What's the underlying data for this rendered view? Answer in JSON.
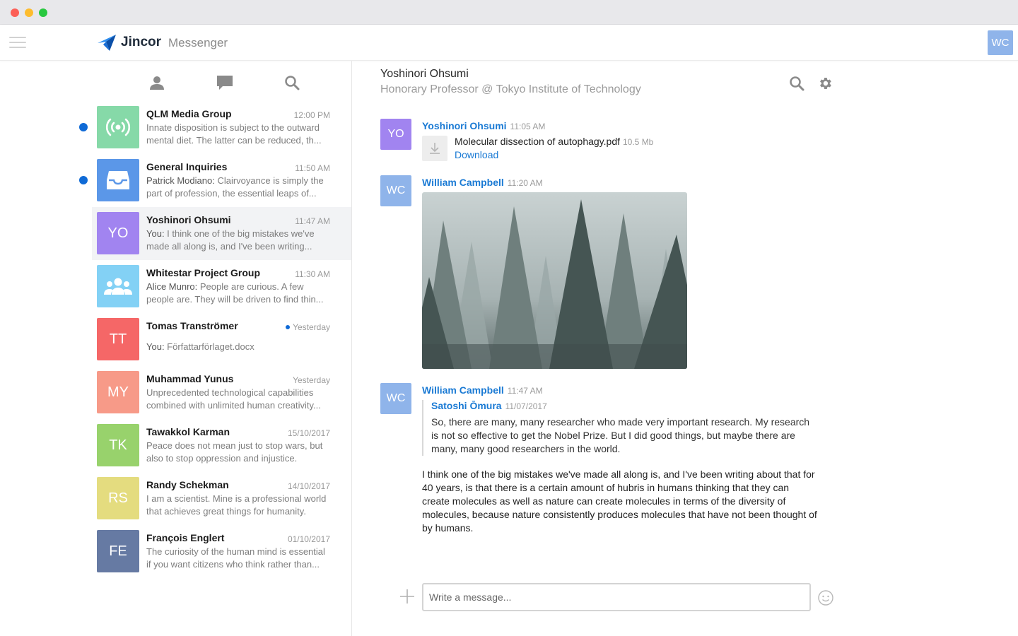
{
  "window": {
    "controls": [
      "close",
      "minimize",
      "maximize"
    ]
  },
  "header": {
    "brand": "Jincor",
    "subtitle": "Messenger",
    "user_initials": "WC",
    "user_color": "#8fb4ea"
  },
  "sidebar": {
    "tabs": [
      {
        "icon": "contacts-icon"
      },
      {
        "icon": "chat-bubble-icon"
      },
      {
        "icon": "search-icon"
      }
    ],
    "conversations": [
      {
        "name": "QLM Media Group",
        "time": "12:00 PM",
        "sender": "",
        "preview": "Innate disposition is subject to the outward mental diet. The latter can be reduced, th...",
        "avatar_icon": "broadcast-icon",
        "avatar_color": "#86d9a8",
        "unread": true
      },
      {
        "name": "General Inquiries",
        "time": "11:50 AM",
        "sender": "Patrick Modiano:",
        "preview": " Clairvoyance is simply the part of profession, the essential leaps of...",
        "avatar_icon": "inbox-icon",
        "avatar_color": "#5b97e8",
        "unread": true
      },
      {
        "name": "Yoshinori Ohsumi",
        "time": "11:47 AM",
        "sender": "You:",
        "preview": " I think one of the big mistakes we've made all along is, and I've been writing...",
        "initials": "YO",
        "avatar_color": "#a184f0",
        "active": true
      },
      {
        "name": "Whitestar Project Group",
        "time": "11:30 AM",
        "sender": "Alice Munro:",
        "preview": "  People are curious. A few people are. They will be driven to find thin...",
        "avatar_icon": "group-icon",
        "avatar_color": "#83d1f5"
      },
      {
        "name": "Tomas Tranströmer",
        "time": "Yesterday",
        "sender": "You:",
        "preview": " Författarförlaget.docx",
        "initials": "TT",
        "avatar_color": "#f56767",
        "time_dot": true
      },
      {
        "name": "Muhammad Yunus",
        "time": "Yesterday",
        "sender": "",
        "preview": "Unprecedented technological capabilities combined with unlimited human creativity...",
        "initials": "MY",
        "avatar_color": "#f79a88"
      },
      {
        "name": "Tawakkol Karman",
        "time": "15/10/2017",
        "sender": "",
        "preview": "Peace does not mean just to stop wars, but also to stop oppression and injustice.",
        "initials": "TK",
        "avatar_color": "#98d26c"
      },
      {
        "name": "Randy Schekman",
        "time": "14/10/2017",
        "sender": "",
        "preview": "I am a scientist. Mine is a professional world that achieves great things for humanity.",
        "initials": "RS",
        "avatar_color": "#e4dc7f"
      },
      {
        "name": "François Englert",
        "time": "01/10/2017",
        "sender": "",
        "preview": "The curiosity of the human mind is essential if you want citizens who think rather than...",
        "initials": "FE",
        "avatar_color": "#667aa3"
      }
    ]
  },
  "chat": {
    "contact_name": "Yoshinori Ohsumi",
    "contact_title": "Honorary Professor @ Tokyo Institute of Technology",
    "messages": [
      {
        "initials": "YO",
        "avatar_color": "#a184f0",
        "author": "Yoshinori Ohsumi",
        "time": "11:05 AM",
        "file_name": "Molecular dissection of autophagy.pdf",
        "file_size": "10.5 Mb",
        "download_label": "Download"
      },
      {
        "initials": "WC",
        "avatar_color": "#8fb4ea",
        "author": "William Campbell",
        "time": "11:20 AM",
        "image": "foggy-forest-photo"
      },
      {
        "initials": "WC",
        "avatar_color": "#8fb4ea",
        "author": "William Campbell",
        "time": "11:47 AM",
        "quote_author": "Satoshi Ōmura",
        "quote_date": "11/07/2017",
        "quote_text": "So, there are many, many researcher who made very important research. My research is not so effective to get the Nobel Prize. But I did good things, but maybe there are many, many good researchers in the world.",
        "text": "I think one of the big mistakes we've made all along is, and I've been writing about that for 40 years, is that there is a certain amount of hubris in humans thinking that they can create molecules as well as nature can create molecules in terms of the diversity of molecules, because nature consistently produces molecules that have not been thought of by humans."
      }
    ],
    "composer_placeholder": "Write a message...",
    "accent_color": "#1a7ad4"
  }
}
